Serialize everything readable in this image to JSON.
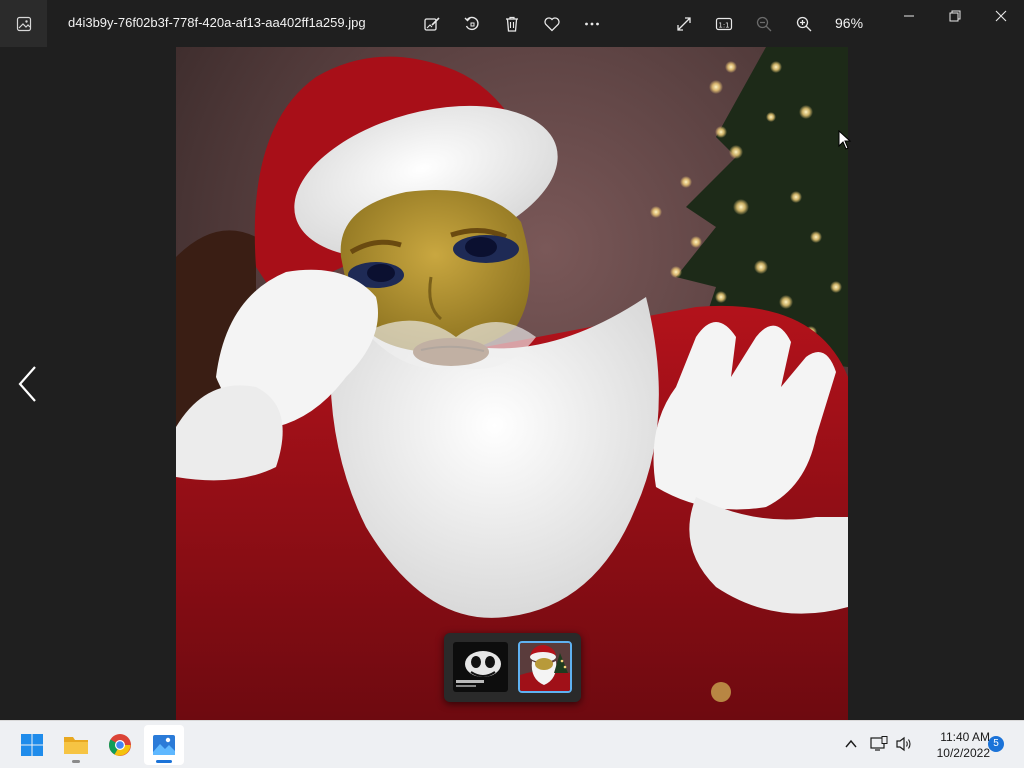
{
  "window": {
    "filename": "d4i3b9y-76f02b3f-778f-420a-af13-aa402ff1a259.jpg",
    "zoom": "96%"
  },
  "toolbar": {
    "icons": [
      "edit-image-icon",
      "rotate-icon",
      "delete-icon",
      "favorite-icon",
      "more-icon"
    ],
    "right_icons": [
      "fullscreen-icon",
      "actual-size-icon",
      "zoom-out-icon",
      "zoom-in-icon"
    ]
  },
  "window_controls": [
    "minimize-icon",
    "restore-icon",
    "close-icon"
  ],
  "filmstrip": {
    "items": [
      {
        "name": "thumb-skull-meme",
        "selected": false
      },
      {
        "name": "thumb-santa",
        "selected": true
      }
    ]
  },
  "taskbar": {
    "apps": [
      "windows-start",
      "file-explorer",
      "chrome",
      "photos"
    ],
    "time": "11:40 AM",
    "date": "10/2/2022",
    "notifications": "5"
  },
  "colors": {
    "background": "#1f1f1f",
    "accent": "#1b73d8",
    "selected_thumb": "#5fb2f2"
  }
}
